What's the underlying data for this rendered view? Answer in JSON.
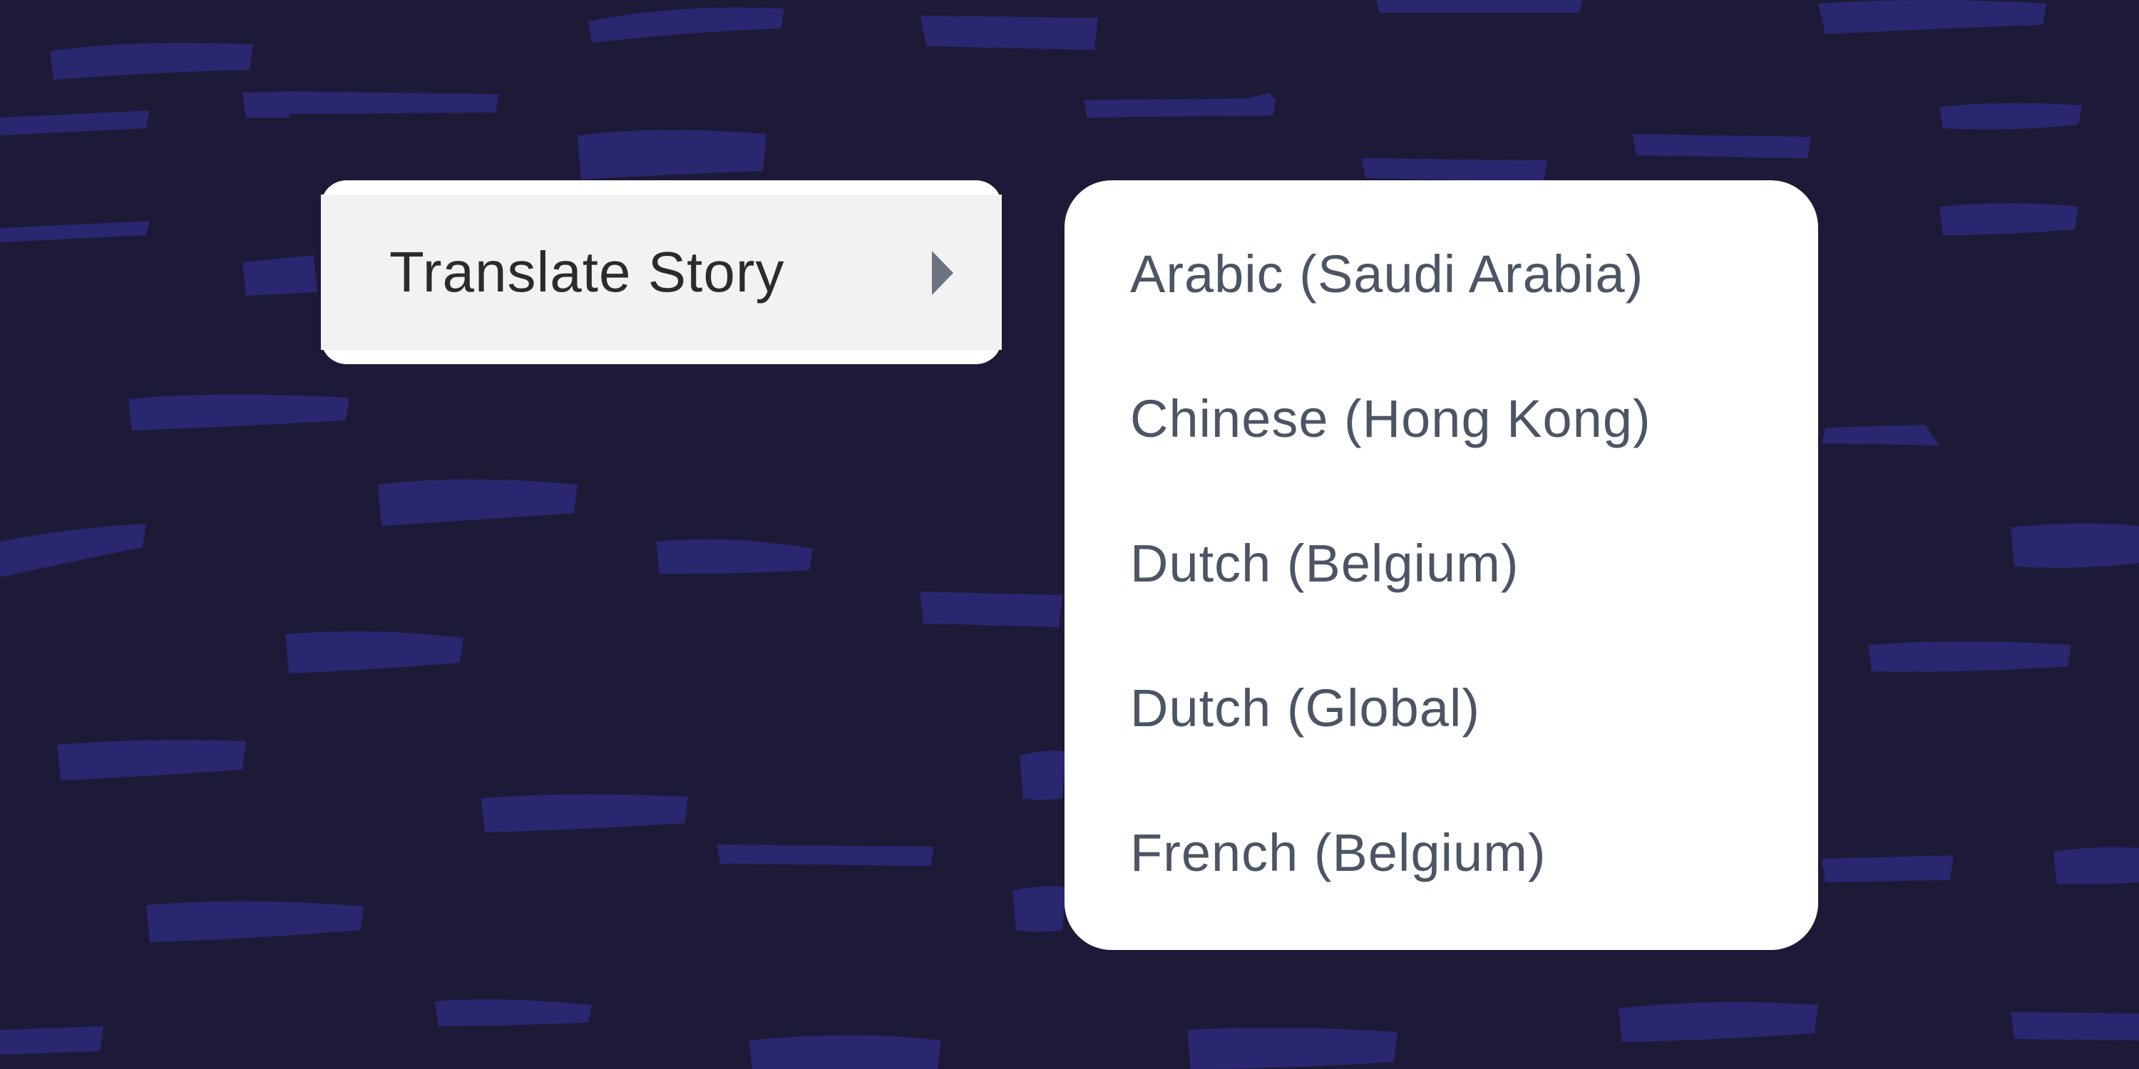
{
  "background": {
    "color": "#1c1a36",
    "stroke_color": "#2a2670"
  },
  "context_menu": {
    "item_label": "Translate Story",
    "submenu_indicator_icon": "caret-right-icon"
  },
  "submenu": {
    "items": [
      {
        "label": "Arabic (Saudi Arabia)"
      },
      {
        "label": "Chinese (Hong Kong)"
      },
      {
        "label": "Dutch (Belgium)"
      },
      {
        "label": "Dutch (Global)"
      },
      {
        "label": "French (Belgium)"
      }
    ]
  }
}
